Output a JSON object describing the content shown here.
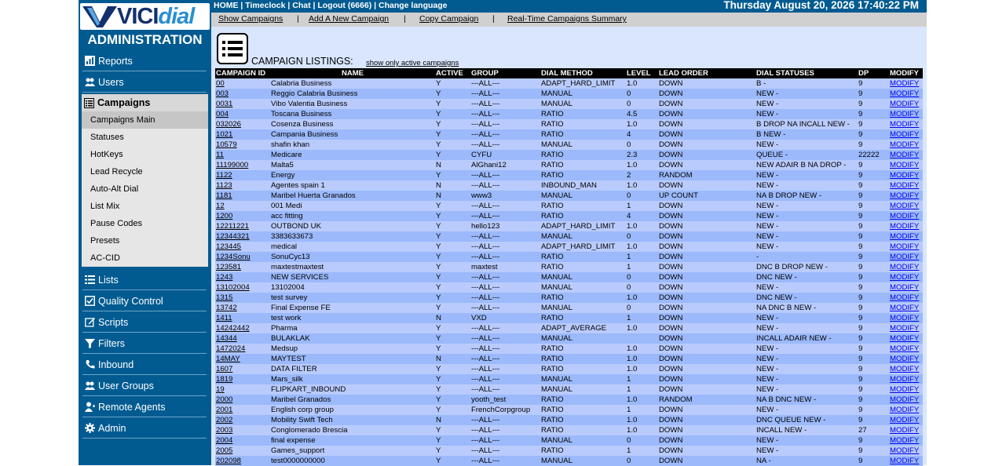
{
  "app": {
    "logo_text_1": "VICI",
    "logo_text_2": "dial",
    "section_title": "ADMINISTRATION"
  },
  "header": {
    "links": [
      "HOME",
      "Timeclock",
      "Chat",
      "Logout (6666)",
      "Change language"
    ],
    "separator": " | ",
    "datetime": "Thursday August 20, 2026 17:40:22 PM"
  },
  "subnav": {
    "links": [
      "Show Campaigns",
      "Add A New Campaign",
      "Copy Campaign",
      "Real-Time Campaigns Summary"
    ],
    "separator": "|"
  },
  "sidebar": {
    "items": [
      {
        "label": "Reports",
        "icon": "chart-icon"
      },
      {
        "label": "Users",
        "icon": "users-icon"
      },
      {
        "label": "Campaigns",
        "icon": "list-icon",
        "active": true
      },
      {
        "label": "Lists",
        "icon": "list-icon"
      },
      {
        "label": "Quality Control",
        "icon": "checkbox-icon"
      },
      {
        "label": "Scripts",
        "icon": "edit-icon"
      },
      {
        "label": "Filters",
        "icon": "filter-icon"
      },
      {
        "label": "Inbound",
        "icon": "phone-icon"
      },
      {
        "label": "User Groups",
        "icon": "users-icon"
      },
      {
        "label": "Remote Agents",
        "icon": "agent-icon"
      },
      {
        "label": "Admin",
        "icon": "gear-icon"
      }
    ],
    "submenu": [
      {
        "label": "Campaigns Main",
        "active": true
      },
      {
        "label": "Statuses"
      },
      {
        "label": "HotKeys"
      },
      {
        "label": "Lead Recycle"
      },
      {
        "label": "Auto-Alt Dial"
      },
      {
        "label": "List Mix"
      },
      {
        "label": "Pause Codes"
      },
      {
        "label": "Presets"
      },
      {
        "label": "AC-CID"
      }
    ]
  },
  "main": {
    "title": "CAMPAIGN LISTINGS:",
    "active_filter_link": "show only active campaigns",
    "columns": [
      "CAMPAIGN ID",
      "NAME",
      "ACTIVE",
      "GROUP",
      "DIAL METHOD",
      "LEVEL",
      "LEAD ORDER",
      "DIAL STATUSES",
      "DP",
      "MODIFY"
    ],
    "modify_label": "MODIFY",
    "rows": [
      [
        "00",
        "Calabria Business",
        "Y",
        "---ALL---",
        "ADAPT_HARD_LIMIT",
        "1.0",
        "DOWN",
        "B -",
        "9"
      ],
      [
        "003",
        "Reggio Calabria Business",
        "Y",
        "---ALL---",
        "MANUAL",
        "0",
        "DOWN",
        "NEW -",
        "9"
      ],
      [
        "0031",
        "Vibo Valentia Business",
        "Y",
        "---ALL---",
        "MANUAL",
        "0",
        "DOWN",
        "NEW -",
        "9"
      ],
      [
        "004",
        "Toscana Business",
        "Y",
        "---ALL---",
        "RATIO",
        "4.5",
        "DOWN",
        "NEW -",
        "9"
      ],
      [
        "032026",
        "Cosenza Business",
        "Y",
        "---ALL---",
        "RATIO",
        "1.0",
        "DOWN",
        "B DROP NA INCALL NEW -",
        "9"
      ],
      [
        "1021",
        "Campania Business",
        "Y",
        "---ALL---",
        "RATIO",
        "4",
        "DOWN",
        "B NEW -",
        "9"
      ],
      [
        "10579",
        "shafin khan",
        "Y",
        "---ALL---",
        "MANUAL",
        "0",
        "DOWN",
        "NEW -",
        "9"
      ],
      [
        "11",
        "Medicare",
        "Y",
        "CYFU",
        "RATIO",
        "2.3",
        "DOWN",
        "QUEUE -",
        "22222"
      ],
      [
        "11199000",
        "Malta5",
        "N",
        "AlGhani12",
        "RATIO",
        "1.0",
        "DOWN",
        "NEW ADAIR B NA DROP -",
        "9"
      ],
      [
        "1122",
        "Energy",
        "Y",
        "---ALL---",
        "RATIO",
        "2",
        "RANDOM",
        "NEW -",
        "9"
      ],
      [
        "1123",
        "Agentes spain 1",
        "N",
        "---ALL---",
        "INBOUND_MAN",
        "1.0",
        "DOWN",
        "NEW -",
        "9"
      ],
      [
        "1181",
        "Maribel Huerta Granados",
        "N",
        "www3",
        "MANUAL",
        "0",
        "UP COUNT",
        "NA B DROP NEW -",
        "9"
      ],
      [
        "12",
        "001 Medi",
        "Y",
        "---ALL---",
        "RATIO",
        "1",
        "DOWN",
        "NEW -",
        "9"
      ],
      [
        "1200",
        "acc fitting",
        "Y",
        "---ALL---",
        "RATIO",
        "4",
        "DOWN",
        "NEW -",
        "9"
      ],
      [
        "12211221",
        "OUTBOND UK",
        "Y",
        "hello123",
        "ADAPT_HARD_LIMIT",
        "1.0",
        "DOWN",
        "NEW -",
        "9"
      ],
      [
        "12344321",
        "3383633673",
        "Y",
        "---ALL---",
        "MANUAL",
        "0",
        "DOWN",
        "NEW -",
        "9"
      ],
      [
        "123445",
        "medical",
        "Y",
        "---ALL---",
        "ADAPT_HARD_LIMIT",
        "1.0",
        "DOWN",
        "NEW -",
        "9"
      ],
      [
        "1234Sonu",
        "SonuCyc13",
        "Y",
        "---ALL---",
        "RATIO",
        "1",
        "DOWN",
        "-",
        "9"
      ],
      [
        "123581",
        "maxtestmaxtest",
        "Y",
        "maxtest",
        "RATIO",
        "1",
        "DOWN",
        "DNC B DROP NEW -",
        "9"
      ],
      [
        "1243",
        "NEW SERVICES",
        "Y",
        "---ALL---",
        "MANUAL",
        "0",
        "DOWN",
        "DNC NEW -",
        "9"
      ],
      [
        "13102004",
        "13102004",
        "Y",
        "---ALL---",
        "MANUAL",
        "0",
        "DOWN",
        "NEW -",
        "9"
      ],
      [
        "1315",
        "test survey",
        "Y",
        "---ALL---",
        "RATIO",
        "1.0",
        "DOWN",
        "DNC NEW -",
        "9"
      ],
      [
        "13742",
        "Final Expense FE",
        "Y",
        "---ALL---",
        "MANUAL",
        "0",
        "DOWN",
        "NA DNC B NEW -",
        "9"
      ],
      [
        "1411",
        "test work",
        "N",
        "VXD",
        "RATIO",
        "1",
        "DOWN",
        "NEW -",
        "9"
      ],
      [
        "14242442",
        "Pharma",
        "Y",
        "---ALL---",
        "ADAPT_AVERAGE",
        "1.0",
        "DOWN",
        "NEW -",
        "9"
      ],
      [
        "14344",
        "BULAKLAK",
        "Y",
        "---ALL---",
        "MANUAL",
        "",
        "DOWN",
        "INCALL ADAIR NEW -",
        "9"
      ],
      [
        "1472024",
        "Medsup",
        "Y",
        "---ALL---",
        "RATIO",
        "1.0",
        "DOWN",
        "NEW -",
        "9"
      ],
      [
        "14MAY",
        "MAYTEST",
        "N",
        "---ALL---",
        "RATIO",
        "1.0",
        "DOWN",
        "NEW -",
        "9"
      ],
      [
        "1607",
        "DATA FILTER",
        "Y",
        "---ALL---",
        "RATIO",
        "1.0",
        "DOWN",
        "NEW -",
        "9"
      ],
      [
        "1819",
        "Mars_silk",
        "Y",
        "---ALL---",
        "MANUAL",
        "1",
        "DOWN",
        "NEW -",
        "9"
      ],
      [
        "19",
        "FLIPKART_INBOUND",
        "Y",
        "---ALL---",
        "MANUAL",
        "1",
        "DOWN",
        "NEW -",
        "9"
      ],
      [
        "2000",
        "Maribel Granados",
        "Y",
        "yooth_test",
        "RATIO",
        "1.0",
        "RANDOM",
        "NA B DNC NEW -",
        "9"
      ],
      [
        "2001",
        "English corp group",
        "Y",
        "FrenchCorpgroup",
        "RATIO",
        "1",
        "DOWN",
        "NEW -",
        "9"
      ],
      [
        "2002",
        "Mobility Swift Tech",
        "N",
        "---ALL---",
        "RATIO",
        "1.0",
        "DOWN",
        "DNC QUEUE NEW -",
        "9"
      ],
      [
        "2003",
        "Conglomerado Brescia",
        "Y",
        "---ALL---",
        "RATIO",
        "1.0",
        "DOWN",
        "INCALL NEW -",
        "27"
      ],
      [
        "2004",
        "final expense",
        "Y",
        "---ALL---",
        "MANUAL",
        "0",
        "DOWN",
        "NEW -",
        "9"
      ],
      [
        "2005",
        "Games_support",
        "Y",
        "---ALL---",
        "RATIO",
        "1",
        "DOWN",
        "NEW -",
        "9"
      ],
      [
        "202098",
        "test0000000000",
        "Y",
        "---ALL---",
        "MANUAL",
        "0",
        "DOWN",
        "NA -",
        "9"
      ]
    ]
  }
}
